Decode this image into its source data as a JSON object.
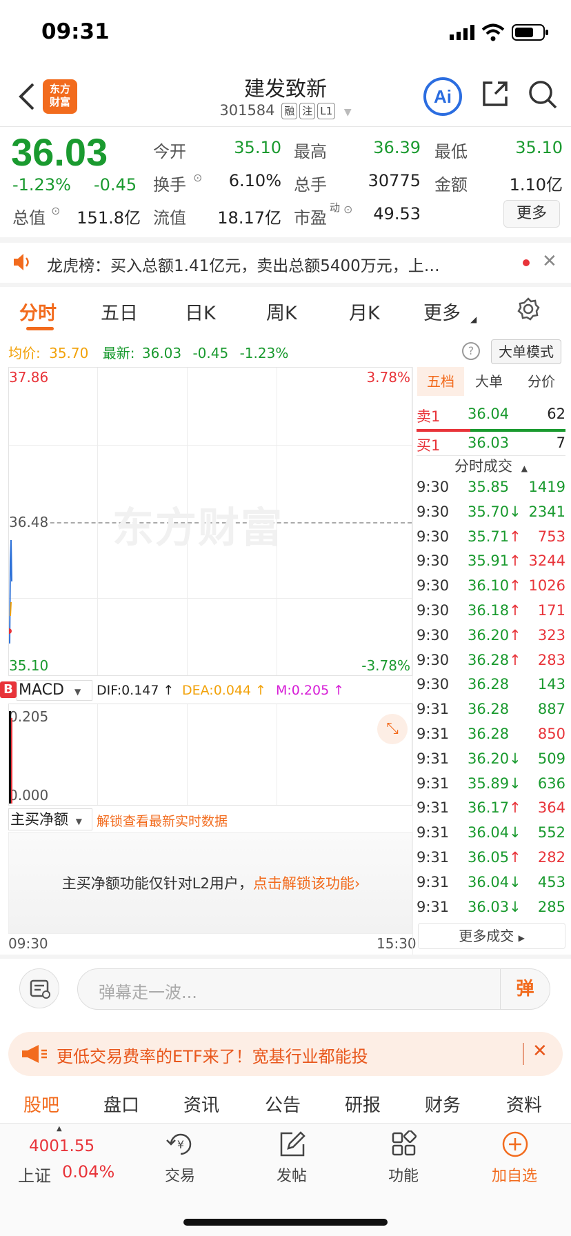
{
  "status_bar": {
    "time": "09:31"
  },
  "header": {
    "title": "建发致新",
    "code": "301584",
    "tags": [
      "融",
      "注",
      "L1"
    ],
    "logo_text": "东方财富"
  },
  "quote": {
    "price": "36.03",
    "change_pct": "-1.23%",
    "change": "-0.45",
    "fields": [
      {
        "label": "今开",
        "value": "35.10",
        "color": "#1a9a2f"
      },
      {
        "label": "最高",
        "value": "36.39",
        "color": "#1a9a2f"
      },
      {
        "label": "最低",
        "value": "35.10",
        "color": "#1a9a2f"
      },
      {
        "label": "换手",
        "value": "6.10%",
        "color": "#222222"
      },
      {
        "label": "总手",
        "value": "30775",
        "color": "#222222"
      },
      {
        "label": "金额",
        "value": "1.10亿",
        "color": "#222222"
      },
      {
        "label": "总值",
        "value": "151.8亿",
        "color": "#222222"
      },
      {
        "label": "流值",
        "value": "18.17亿",
        "color": "#222222"
      },
      {
        "label": "市盈",
        "value": "49.53",
        "color": "#222222"
      }
    ],
    "pe_superscript": "动",
    "more_button": "更多"
  },
  "notice": {
    "text": "龙虎榜：买入总额1.41亿元，卖出总额5400万元，上…"
  },
  "chart_tabs": [
    "分时",
    "五日",
    "日K",
    "周K",
    "月K",
    "更多"
  ],
  "chart_tab_active": "分时",
  "chart_info": {
    "avg_label": "均价:",
    "avg_value": "35.70",
    "latest_label": "最新:",
    "latest_value": "36.03",
    "change": "-0.45",
    "change_pct": "-1.23%",
    "mode_button": "大单模式"
  },
  "chart_axis": {
    "top_price": "37.86",
    "mid_price": "36.48",
    "bottom_price": "35.10",
    "top_pct": "3.78%",
    "bottom_pct": "-3.78%",
    "start_time": "09:30",
    "end_time": "15:30",
    "watermark": "东方财富"
  },
  "macd": {
    "badge": "B",
    "selector": "MACD",
    "dif": "DIF:0.147 ↑",
    "dea": "DEA:0.044 ↑",
    "m": "M:0.205 ↑",
    "top_value": "0.205",
    "bottom_value": "0.000"
  },
  "net_buy": {
    "selector": "主买净额",
    "unlock_text": "解锁查看最新实时数据",
    "message": "主买净额功能仅针对L2用户，",
    "message_link": "点击解锁该功能›"
  },
  "side_panel": {
    "tabs": [
      "五档",
      "大单",
      "分价"
    ],
    "active_tab": "五档",
    "sell1": {
      "label": "卖1",
      "price": "36.04",
      "vol": "62"
    },
    "buy1": {
      "label": "买1",
      "price": "36.03",
      "vol": "7"
    },
    "ticks_header": "分时成交",
    "more_ticks": "更多成交",
    "ticks": [
      {
        "t": "9:30",
        "p": "35.85",
        "dir": "",
        "v": "1419",
        "pc": "#1a9a2f",
        "vc": "#1a9a2f"
      },
      {
        "t": "9:30",
        "p": "35.70",
        "dir": "↓",
        "v": "2341",
        "pc": "#1a9a2f",
        "vc": "#1a9a2f"
      },
      {
        "t": "9:30",
        "p": "35.71",
        "dir": "↑",
        "v": "753",
        "pc": "#1a9a2f",
        "vc": "#e8343a"
      },
      {
        "t": "9:30",
        "p": "35.91",
        "dir": "↑",
        "v": "3244",
        "pc": "#1a9a2f",
        "vc": "#e8343a"
      },
      {
        "t": "9:30",
        "p": "36.10",
        "dir": "↑",
        "v": "1026",
        "pc": "#1a9a2f",
        "vc": "#e8343a"
      },
      {
        "t": "9:30",
        "p": "36.18",
        "dir": "↑",
        "v": "171",
        "pc": "#1a9a2f",
        "vc": "#e8343a"
      },
      {
        "t": "9:30",
        "p": "36.20",
        "dir": "↑",
        "v": "323",
        "pc": "#1a9a2f",
        "vc": "#e8343a"
      },
      {
        "t": "9:30",
        "p": "36.28",
        "dir": "↑",
        "v": "283",
        "pc": "#1a9a2f",
        "vc": "#e8343a"
      },
      {
        "t": "9:30",
        "p": "36.28",
        "dir": "",
        "v": "143",
        "pc": "#1a9a2f",
        "vc": "#1a9a2f"
      },
      {
        "t": "9:31",
        "p": "36.28",
        "dir": "",
        "v": "887",
        "pc": "#1a9a2f",
        "vc": "#1a9a2f"
      },
      {
        "t": "9:31",
        "p": "36.28",
        "dir": "",
        "v": "850",
        "pc": "#1a9a2f",
        "vc": "#e8343a"
      },
      {
        "t": "9:31",
        "p": "36.20",
        "dir": "↓",
        "v": "509",
        "pc": "#1a9a2f",
        "vc": "#1a9a2f"
      },
      {
        "t": "9:31",
        "p": "35.89",
        "dir": "↓",
        "v": "636",
        "pc": "#1a9a2f",
        "vc": "#1a9a2f"
      },
      {
        "t": "9:31",
        "p": "36.17",
        "dir": "↑",
        "v": "364",
        "pc": "#1a9a2f",
        "vc": "#e8343a"
      },
      {
        "t": "9:31",
        "p": "36.04",
        "dir": "↓",
        "v": "552",
        "pc": "#1a9a2f",
        "vc": "#1a9a2f"
      },
      {
        "t": "9:31",
        "p": "36.05",
        "dir": "↑",
        "v": "282",
        "pc": "#1a9a2f",
        "vc": "#e8343a"
      },
      {
        "t": "9:31",
        "p": "36.04",
        "dir": "↓",
        "v": "453",
        "pc": "#1a9a2f",
        "vc": "#1a9a2f"
      },
      {
        "t": "9:31",
        "p": "36.03",
        "dir": "↓",
        "v": "285",
        "pc": "#1a9a2f",
        "vc": "#1a9a2f"
      }
    ]
  },
  "danmaku": {
    "placeholder": "弹幕走一波...",
    "button": "弹"
  },
  "ad_banner": {
    "text": "更低交易费率的ETF来了！宽基行业都能投"
  },
  "section_tabs": [
    "股吧",
    "盘口",
    "资讯",
    "公告",
    "研报",
    "财务",
    "资料"
  ],
  "section_tab_active": "股吧",
  "bottom_bar": {
    "index_value": "4001.55",
    "index_name": "上证",
    "index_change": "0.04%",
    "items": [
      "交易",
      "发帖",
      "功能",
      "加自选"
    ]
  },
  "colors": {
    "accent": "#f26b1d",
    "up": "#e8343a",
    "down": "#1a9a2f",
    "avg": "#f2a20a"
  }
}
